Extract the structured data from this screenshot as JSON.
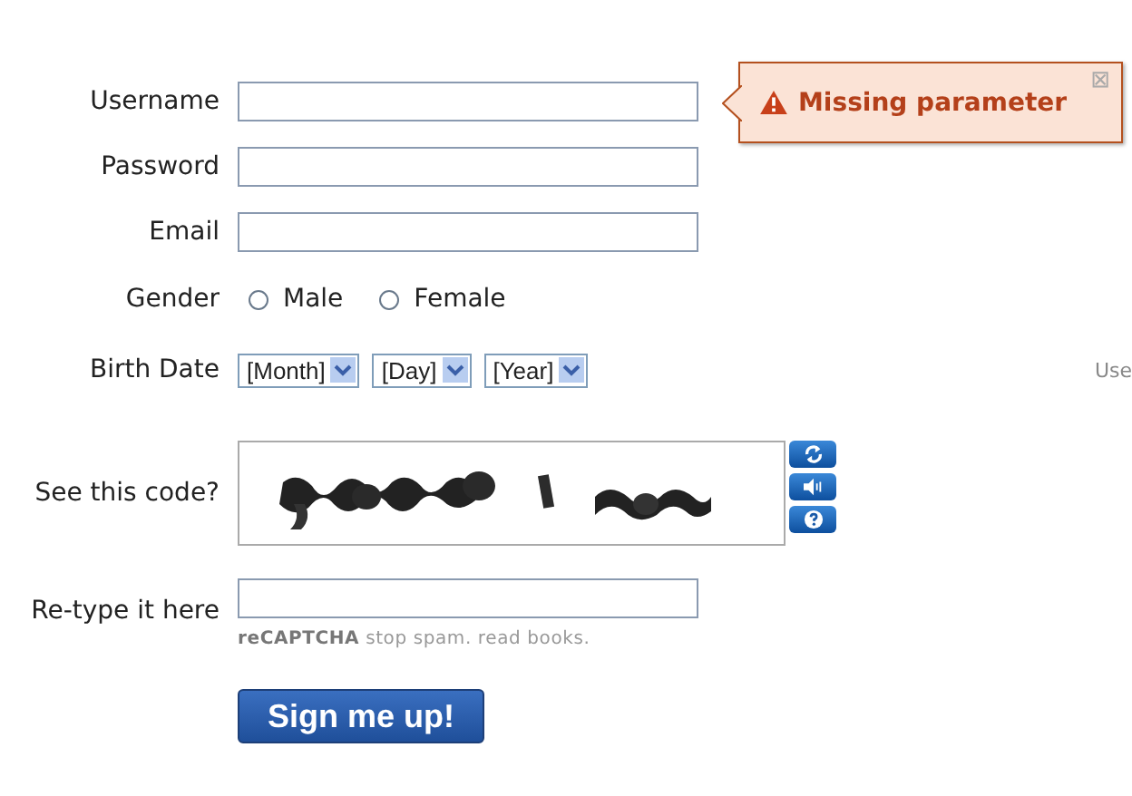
{
  "fields": [
    {
      "label": "Username"
    },
    {
      "label": "Password"
    },
    {
      "label": "Email"
    }
  ],
  "error_tooltip": {
    "message": "Missing parameter",
    "close": "⊠"
  },
  "gender": {
    "label": "Gender",
    "options": [
      {
        "label": "Male",
        "selected": false
      },
      {
        "label": "Female",
        "selected": false
      }
    ]
  },
  "birth_date": {
    "label": "Birth Date",
    "selects": [
      "[Month]",
      "[Day]",
      "[Year]"
    ],
    "side_text": "Use"
  },
  "captcha": {
    "label": "See this code?",
    "retype_label": "Re-type it here",
    "brand": "reCAPTCHA",
    "tagline": "stop spam. read books."
  },
  "submit": "Sign me up!"
}
